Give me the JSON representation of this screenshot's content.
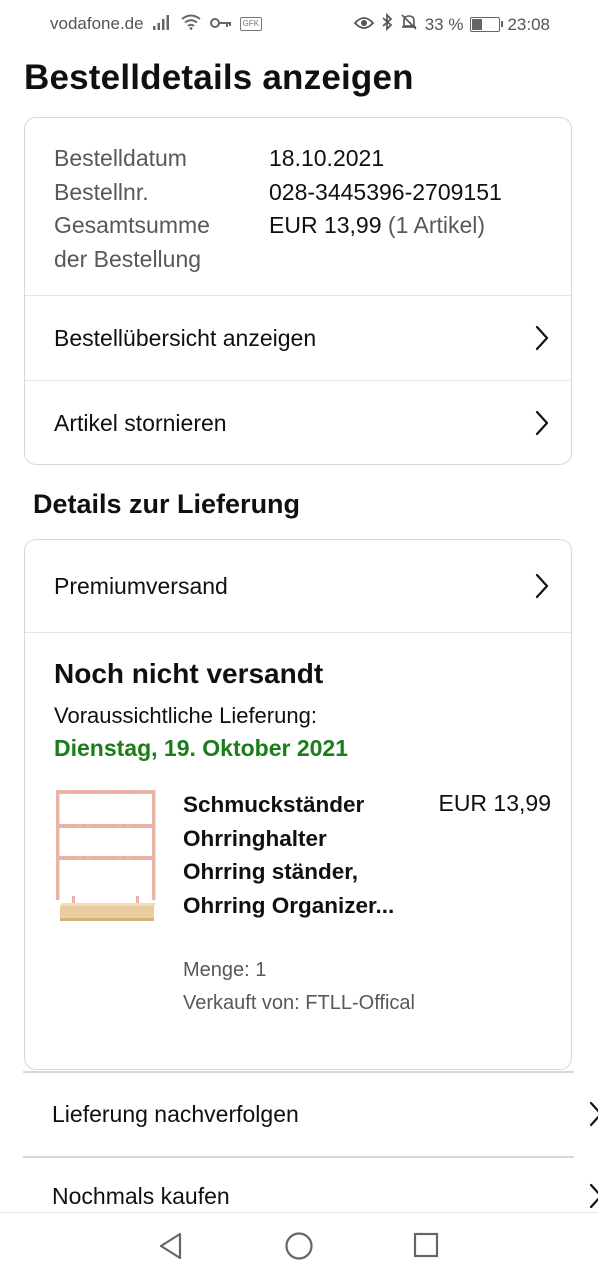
{
  "status_bar": {
    "carrier": "vodafone.de",
    "gfk": "GFK",
    "battery_percent": "33 %",
    "battery_level": 0.33,
    "time": "23:08"
  },
  "page": {
    "title": "Bestelldetails anzeigen"
  },
  "order": {
    "date_label": "Bestelldatum",
    "date_value": "18.10.2021",
    "number_label": "Bestellnr.",
    "number_value": "028-3445396-2709151",
    "total_label_line1": "Gesamtsumme",
    "total_label_line2": "der Bestellung",
    "total_value": "EUR 13,99",
    "total_count": "(1 Artikel)"
  },
  "order_actions": {
    "summary_label": "Bestellübersicht anzeigen",
    "cancel_label": "Artikel stornieren"
  },
  "delivery": {
    "section_title": "Details zur Lieferung",
    "shipping_method": "Premiumversand",
    "status": "Noch nicht versandt",
    "eta_label": "Voraussichtliche Lieferung:",
    "eta_date": "Dienstag, 19. Oktober 2021",
    "colors": {
      "eta_green": "#1a7d1a"
    }
  },
  "product": {
    "title": "Schmuckständer Ohrringhalter Ohrring ständer, Ohrring Organizer...",
    "price": "EUR 13,99",
    "quantity": "Menge: 1",
    "seller": "Verkauft von: FTLL-Offical",
    "image_icon": "jewelry-stand-image"
  },
  "bottom_actions": {
    "track_label": "Lieferung nachverfolgen",
    "buy_again_label": "Nochmals kaufen"
  },
  "nav_bar": {
    "back_icon": "back-triangle-icon",
    "home_icon": "home-circle-icon",
    "recents_icon": "recents-square-icon"
  }
}
